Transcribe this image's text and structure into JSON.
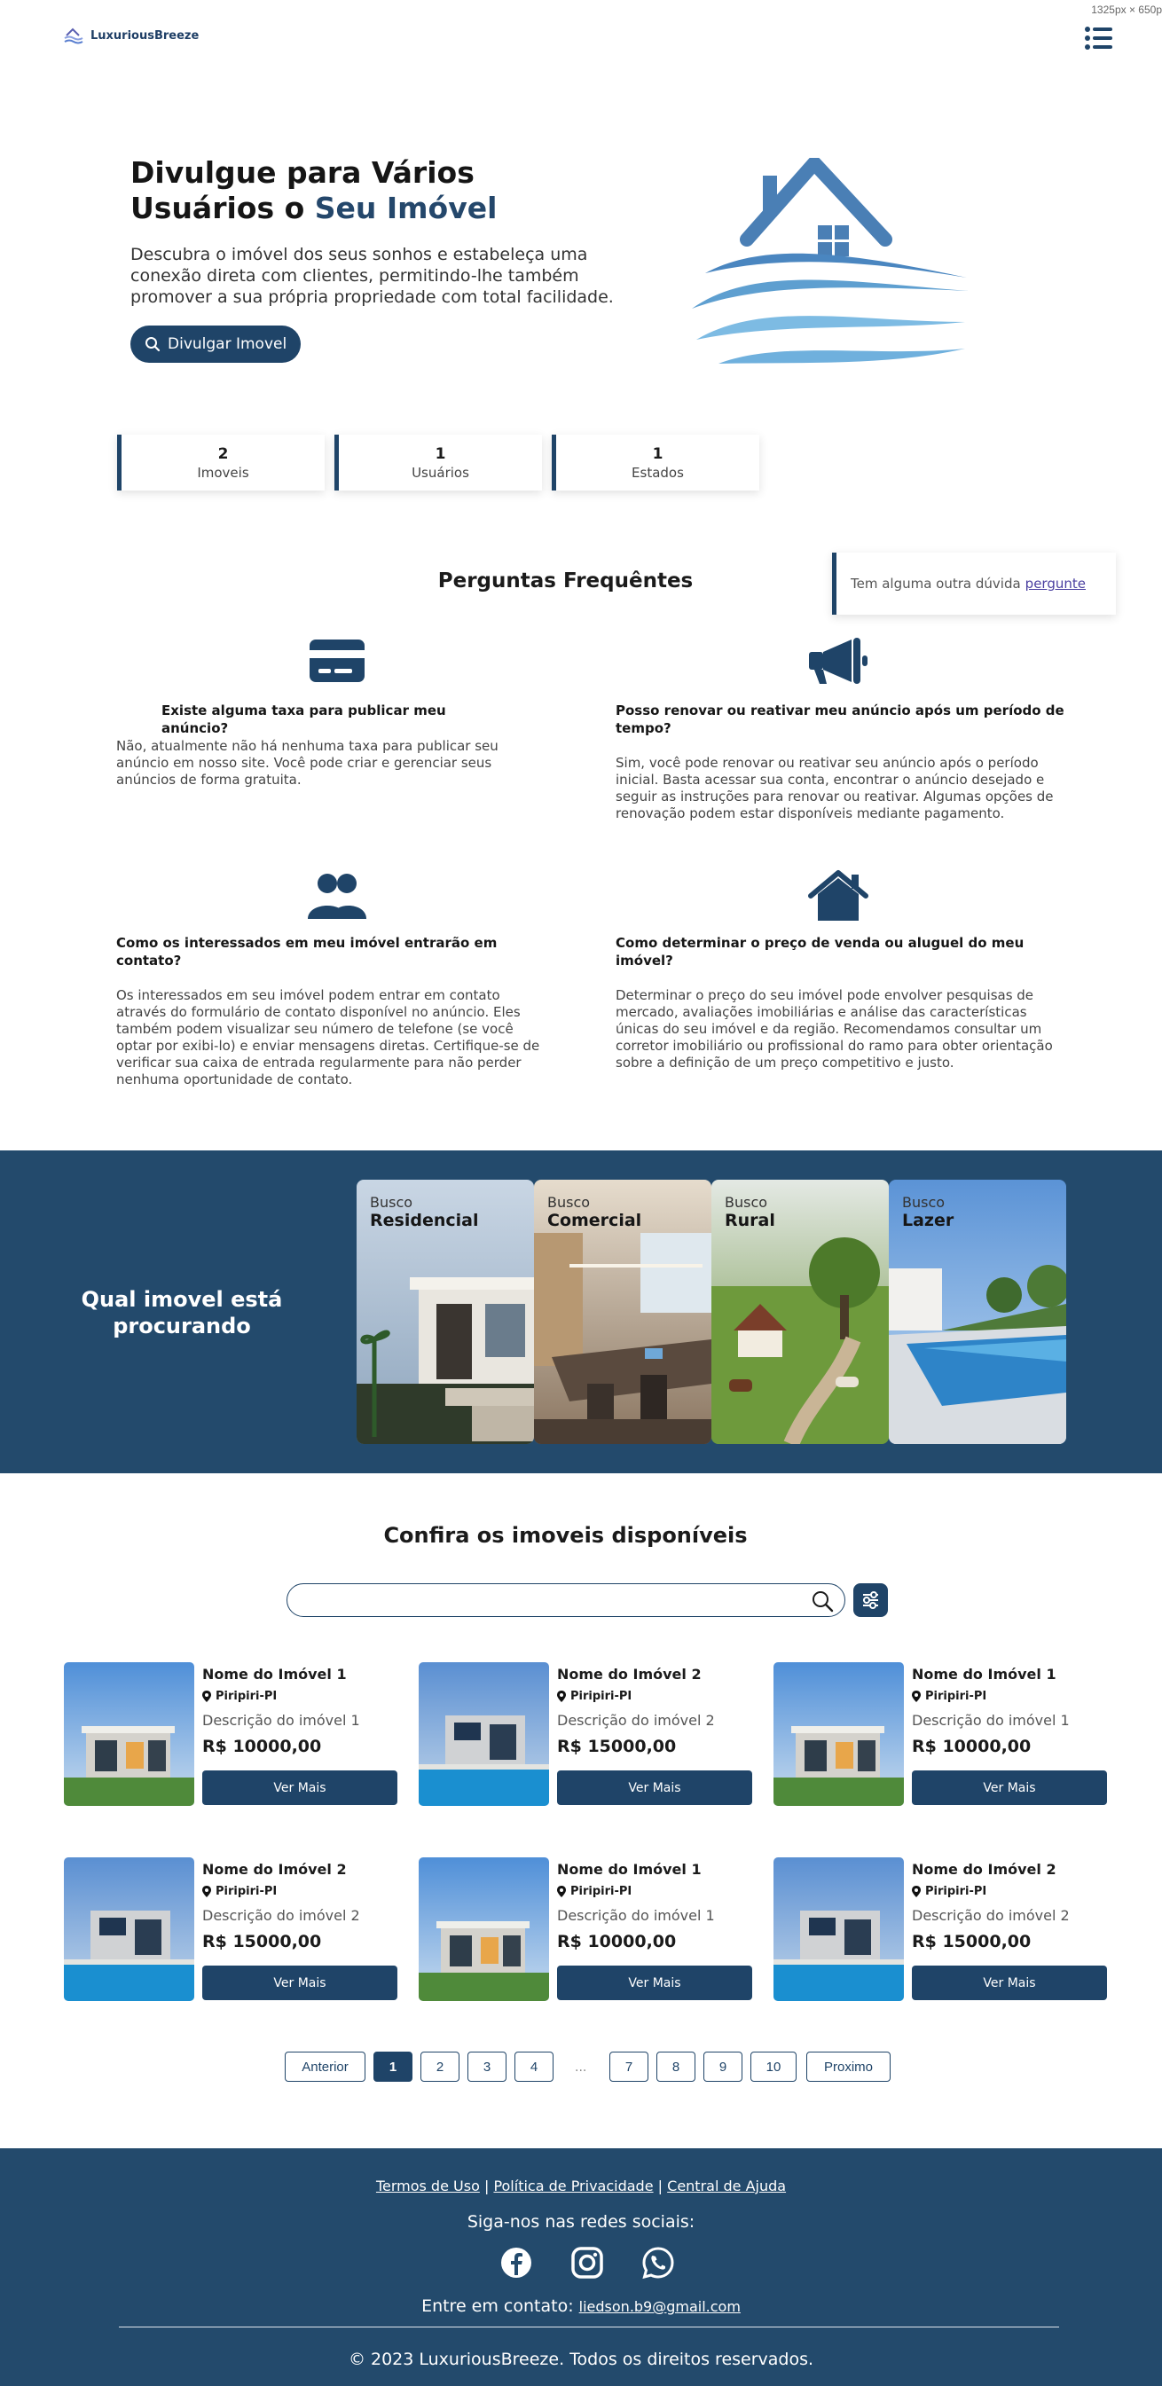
{
  "viewport_tag": "1325px × 650p",
  "brand": {
    "name": "LuxuriousBreeze",
    "color": "#1f4468"
  },
  "hero": {
    "title_line1": "Divulgue para Vários",
    "title_line2_prefix": "Usuários o ",
    "title_highlight": "Seu Imóvel",
    "description": "Descubra o imóvel dos seus sonhos e estabeleça uma conexão direta com clientes, permitindo-lhe também promover a sua própria propriedade com total facilidade.",
    "button_label": "Divulgar Imovel"
  },
  "stats": [
    {
      "value": "2",
      "label": "Imoveis"
    },
    {
      "value": "1",
      "label": "Usuários"
    },
    {
      "value": "1",
      "label": "Estados"
    }
  ],
  "faq": {
    "title": "Perguntas Frequêntes",
    "ask_text": "Tem alguma outra dúvida",
    "ask_link": "pergunte",
    "items": [
      {
        "icon": "credit-card-icon",
        "question": "Existe alguma taxa para publicar meu anúncio?",
        "answer": "Não, atualmente não há nenhuma taxa para publicar seu anúncio em nosso site. Você pode criar e gerenciar seus anúncios de forma gratuita."
      },
      {
        "icon": "megaphone-icon",
        "question": "Posso renovar ou reativar meu anúncio após um período de tempo?",
        "answer": "Sim, você pode renovar ou reativar seu anúncio após o período inicial. Basta acessar sua conta, encontrar o anúncio desejado e seguir as instruções para renovar ou reativar. Algumas opções de renovação podem estar disponíveis mediante pagamento."
      },
      {
        "icon": "users-icon",
        "question": "Como os interessados em meu imóvel entrarão em contato?",
        "answer": "Os interessados em seu imóvel podem entrar em contato através do formulário de contato disponível no anúncio. Eles também podem visualizar seu número de telefone (se você optar por exibi-lo) e enviar mensagens diretas. Certifique-se de verificar sua caixa de entrada regularmente para não perder nenhuma oportunidade de contato."
      },
      {
        "icon": "house-icon",
        "question": "Como determinar o preço de venda ou aluguel do meu imóvel?",
        "answer": "Determinar o preço do seu imóvel pode envolver pesquisas de mercado, avaliações imobiliárias e análise das características únicas do seu imóvel e da região. Recomendamos consultar um corretor imobiliário ou profissional do ramo para obter orientação sobre a definição de um preço competitivo e justo."
      }
    ]
  },
  "categories": {
    "title": "Qual imovel está procurando",
    "prefix": "Busco",
    "items": [
      {
        "name": "Residencial"
      },
      {
        "name": "Comercial"
      },
      {
        "name": "Rural"
      },
      {
        "name": "Lazer"
      }
    ]
  },
  "listing": {
    "title": "Confira os imoveis disponíveis",
    "search_placeholder": "",
    "button_label": "Ver Mais",
    "items": [
      {
        "name": "Nome do Imóvel 1",
        "location": "Piripiri-PI",
        "description": "Descrição do imóvel 1",
        "price": "R$ 10000,00"
      },
      {
        "name": "Nome do Imóvel 2",
        "location": "Piripiri-PI",
        "description": "Descrição do imóvel 2",
        "price": "R$ 15000,00"
      },
      {
        "name": "Nome do Imóvel 1",
        "location": "Piripiri-PI",
        "description": "Descrição do imóvel 1",
        "price": "R$ 10000,00"
      },
      {
        "name": "Nome do Imóvel 2",
        "location": "Piripiri-PI",
        "description": "Descrição do imóvel 2",
        "price": "R$ 15000,00"
      },
      {
        "name": "Nome do Imóvel 1",
        "location": "Piripiri-PI",
        "description": "Descrição do imóvel 1",
        "price": "R$ 10000,00"
      },
      {
        "name": "Nome do Imóvel 2",
        "location": "Piripiri-PI",
        "description": "Descrição do imóvel 2",
        "price": "R$ 15000,00"
      }
    ]
  },
  "pagination": {
    "prev": "Anterior",
    "next": "Proximo",
    "ellipsis": "...",
    "pages": [
      "1",
      "2",
      "3",
      "4",
      "7",
      "8",
      "9",
      "10"
    ],
    "current": "1"
  },
  "footer": {
    "links": [
      "Termos de Uso",
      "Política de Privacidade",
      "Central de Ajuda"
    ],
    "separator": "|",
    "follow_text": "Siga-nos nas redes sociais:",
    "contact_label": "Entre em contato:",
    "contact_email": "liedson.b9@gmail.com",
    "copyright": "© 2023 LuxuriousBreeze. Todos os direitos reservados."
  }
}
